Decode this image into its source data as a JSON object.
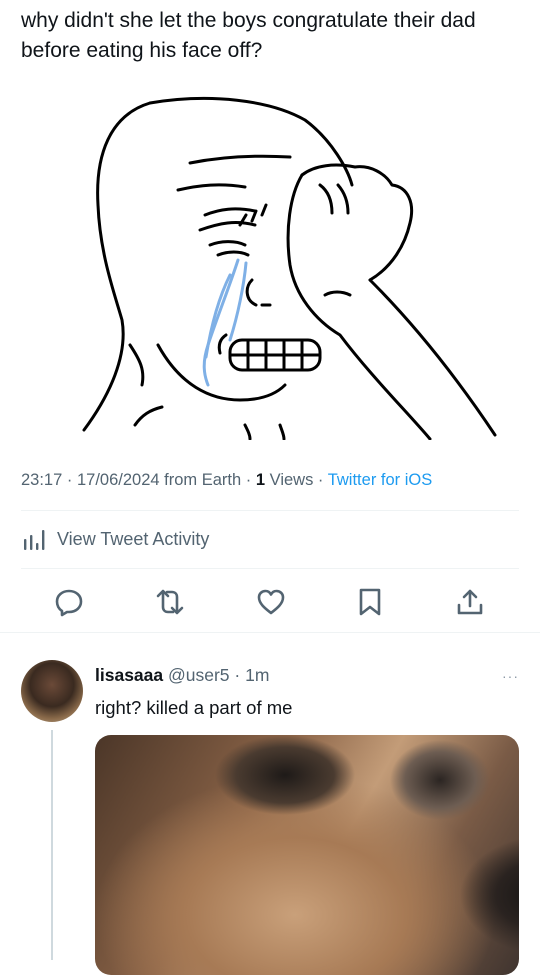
{
  "tweet": {
    "text": "why didn't she let the boys congratulate their dad before eating his face off?",
    "meme_icon": "crying-wojak-icon"
  },
  "meta": {
    "time": "23:17",
    "sep1": " · ",
    "date": "17/06/2024",
    "from": " from Earth",
    "sep2": " · ",
    "views_count": "1",
    "views_label": " Views",
    "sep3": " · ",
    "source": "Twitter for iOS"
  },
  "activity": {
    "label": "View Tweet Activity",
    "icon": "bar-chart-icon"
  },
  "actions": {
    "reply_icon": "reply-icon",
    "retweet_icon": "retweet-icon",
    "like_icon": "heart-icon",
    "bookmark_icon": "bookmark-icon",
    "share_icon": "share-icon"
  },
  "reply": {
    "name": "lisasaaa",
    "handle": " @user5",
    "sep": " · ",
    "time": "1m",
    "more": "···",
    "text": "right? killed a part of me",
    "media_icon": "crying-dog-photo-icon"
  },
  "colors": {
    "text": "#0f1419",
    "muted": "#536471",
    "link": "#1d9bf0",
    "tears": "#7fb0e6"
  }
}
